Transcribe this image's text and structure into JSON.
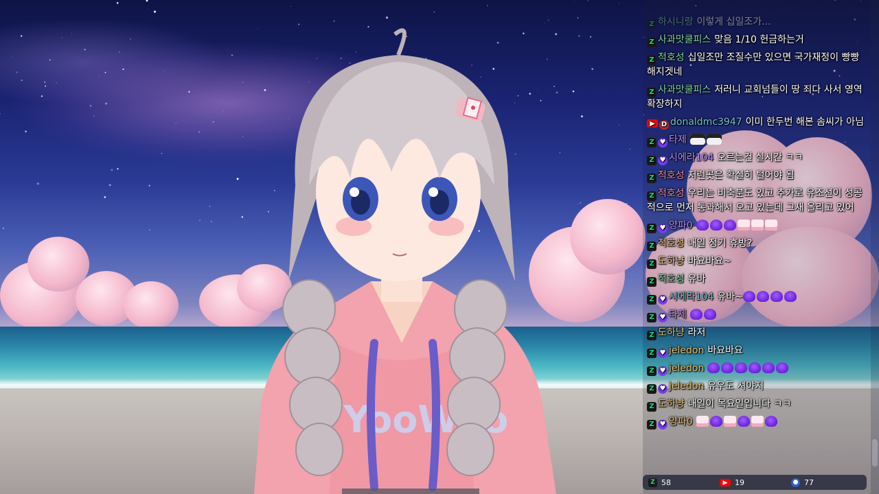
{
  "chat": {
    "messages": [
      {
        "platform": "chzzk",
        "sub": false,
        "nick": "하시니랑",
        "nick_color": "#7fd6a8",
        "text": "이렇게 십일조가...",
        "faded": true,
        "emotes": []
      },
      {
        "platform": "chzzk",
        "sub": false,
        "nick": "사과맛쿨피스",
        "nick_color": "#7fd6a8",
        "text": "맞음 1/10 헌금하는거",
        "faded": false,
        "emotes": []
      },
      {
        "platform": "chzzk",
        "sub": false,
        "nick": "적호성",
        "nick_color": "#7fd6a8",
        "text": "십일조만 조질수만 있으면 국가재정이 빵빵해지겟네",
        "faded": false,
        "emotes": []
      },
      {
        "platform": "chzzk",
        "sub": false,
        "nick": "사과맛쿨피스",
        "nick_color": "#7fd6a8",
        "text": "저러니 교회넘들이 땅 죄다 사서 영역 확장하지",
        "faded": false,
        "emotes": []
      },
      {
        "platform": "youtube",
        "sub": false,
        "nick": "donaldmc3947",
        "nick_color": "#6fc3d8",
        "text": "이미 한두번 해본 솜씨가 아님",
        "faded": false,
        "emotes": []
      },
      {
        "platform": "chzzk",
        "sub": true,
        "nick": "타제",
        "nick_color": "#b48cff",
        "text": "",
        "faded": false,
        "emotes": [
          "shades",
          "shades"
        ]
      },
      {
        "platform": "chzzk",
        "sub": true,
        "nick": "시에라104",
        "nick_color": "#b48cff",
        "text": "오르는건 실시간 ㅋㅋ",
        "faded": false,
        "emotes": []
      },
      {
        "platform": "chzzk",
        "sub": false,
        "nick": "적호성",
        "nick_color": "#e88aa8",
        "text": "저런곳은 확실히 털어야 됨",
        "faded": false,
        "emotes": []
      },
      {
        "platform": "chzzk",
        "sub": false,
        "nick": "적호성",
        "nick_color": "#e88aa8",
        "text": "우리는 비축분도 있고 추가로 유조선이 성공적으로 먼저 통과해서 오고 있는데 그새 올리고 있어",
        "faded": false,
        "emotes": []
      },
      {
        "platform": "chzzk",
        "sub": true,
        "nick": "양파0",
        "nick_color": "#b48cff",
        "text": "",
        "faded": false,
        "emotes": [
          "blob",
          "blob",
          "blob",
          "face",
          "face",
          "face"
        ]
      },
      {
        "platform": "chzzk",
        "sub": false,
        "nick": "적호성",
        "nick_color": "#e6c27a",
        "text": "내일 정기 휴방?",
        "faded": false,
        "emotes": []
      },
      {
        "platform": "chzzk",
        "sub": false,
        "nick": "도하냥",
        "nick_color": "#e6c27a",
        "text": "바요바요~",
        "faded": false,
        "emotes": []
      },
      {
        "platform": "chzzk",
        "sub": false,
        "nick": "적호성",
        "nick_color": "#7fd6a8",
        "text": "유바",
        "faded": false,
        "emotes": []
      },
      {
        "platform": "chzzk",
        "sub": true,
        "nick": "시에라104",
        "nick_color": "#6fc3d8",
        "text": "유바~",
        "faded": false,
        "emotes": [
          "blob",
          "blob",
          "blob",
          "blob"
        ]
      },
      {
        "platform": "chzzk",
        "sub": true,
        "nick": "타제",
        "nick_color": "#b48cff",
        "text": "",
        "faded": false,
        "emotes": [
          "blob",
          "blob"
        ]
      },
      {
        "platform": "chzzk",
        "sub": false,
        "nick": "도하냥",
        "nick_color": "#e6c27a",
        "text": "라저",
        "faded": false,
        "emotes": []
      },
      {
        "platform": "chzzk",
        "sub": true,
        "nick": "jeledon",
        "nick_color": "#e6c27a",
        "text": "바요바요",
        "faded": false,
        "emotes": []
      },
      {
        "platform": "chzzk",
        "sub": true,
        "nick": "jeledon",
        "nick_color": "#e6c27a",
        "text": "",
        "faded": false,
        "emotes": [
          "blob",
          "blob",
          "blob",
          "blob",
          "blob",
          "blob"
        ]
      },
      {
        "platform": "chzzk",
        "sub": true,
        "nick": "jeledon",
        "nick_color": "#e6c27a",
        "text": "유우도 셔야지",
        "faded": false,
        "emotes": []
      },
      {
        "platform": "chzzk",
        "sub": false,
        "nick": "도하냥",
        "nick_color": "#e6c27a",
        "text": "내일이 목요일입니다 ㅋㅋ",
        "faded": false,
        "emotes": []
      },
      {
        "platform": "chzzk",
        "sub": true,
        "nick": "양파0",
        "nick_color": "#e6c27a",
        "text": "",
        "faded": false,
        "emotes": [
          "face",
          "blob",
          "face",
          "blob",
          "face",
          "blob"
        ]
      }
    ]
  },
  "stats": {
    "chzzk_count": "58",
    "youtube_count": "19",
    "other_count": "77"
  },
  "colors": {
    "chzzk_green": "#19e07f",
    "youtube_red": "#ff0000",
    "sub_purple": "#7b3cf0"
  }
}
